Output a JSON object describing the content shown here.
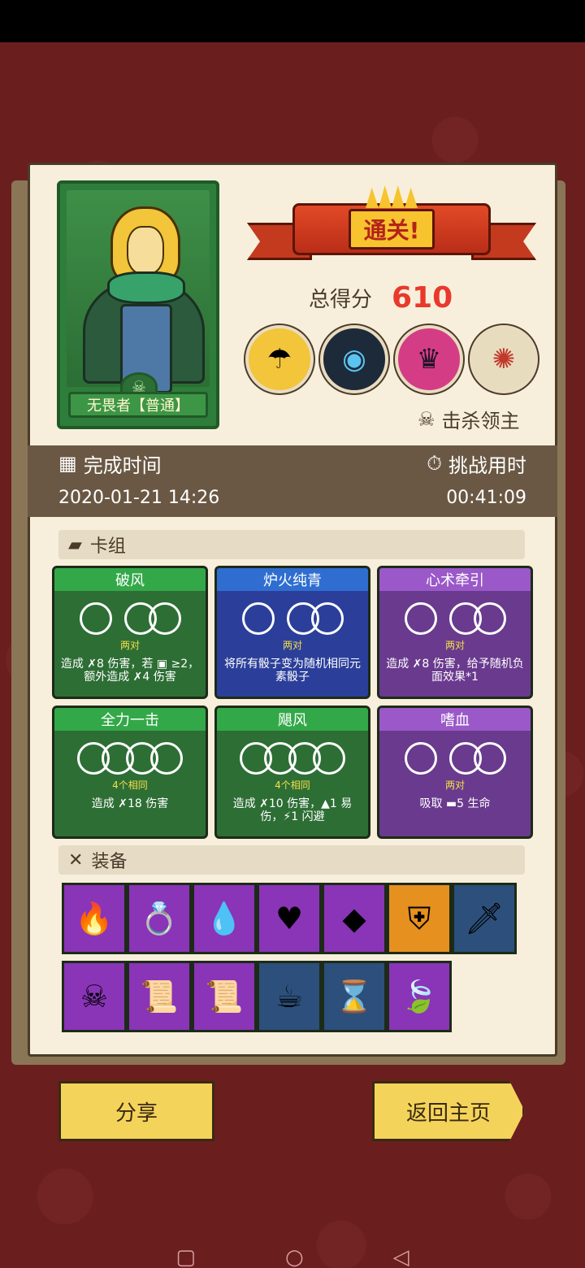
{
  "result": {
    "banner": "通关!",
    "score_label": "总得分",
    "score_value": "610",
    "kills_label": "击杀领主"
  },
  "hero": {
    "name": "无畏者【普通】"
  },
  "info": {
    "finish_label": "完成时间",
    "finish_value": "2020-01-21 14:26",
    "duration_label": "挑战用时",
    "duration_value": "00:41:09"
  },
  "deck": {
    "title": "卡组",
    "cards": [
      {
        "title": "破风",
        "sub": "两对",
        "desc": "造成 ✗8 伤害，若 ▣ ≥2，额外造成 ✗4 伤害",
        "color": "#33a848"
      },
      {
        "title": "炉火纯青",
        "sub": "两对",
        "desc": "将所有骰子变为随机相同元素骰子",
        "color": "#2f6ed0"
      },
      {
        "title": "心术牵引",
        "sub": "两对",
        "desc": "造成 ✗8 伤害，给予随机负面效果*1",
        "color": "#9a58c8"
      },
      {
        "title": "全力一击",
        "sub": "4个相同",
        "desc": "造成 ✗18 伤害",
        "color": "#33a848"
      },
      {
        "title": "飓风",
        "sub": "4个相同",
        "desc": "造成 ✗10 伤害，▲1 易伤，⚡1 闪避",
        "color": "#33a848"
      },
      {
        "title": "嗜血",
        "sub": "两对",
        "desc": "吸取 ▬5 生命",
        "color": "#9a58c8"
      }
    ]
  },
  "equipment": {
    "title": "装备",
    "row1": [
      "flame-pouch-icon",
      "gold-ring-icon",
      "blue-crystal-icon",
      "heart-amulet-icon",
      "green-gem-icon",
      "skull-shield-icon",
      "dagger-icon"
    ],
    "row2": [
      "shadow-mask-icon",
      "skull-scroll-icon",
      "leaf-scroll-icon",
      "spirit-cup-icon",
      "hourglass-icon",
      "green-leaf-icon"
    ]
  },
  "buttons": {
    "share": "分享",
    "home": "返回主页"
  }
}
